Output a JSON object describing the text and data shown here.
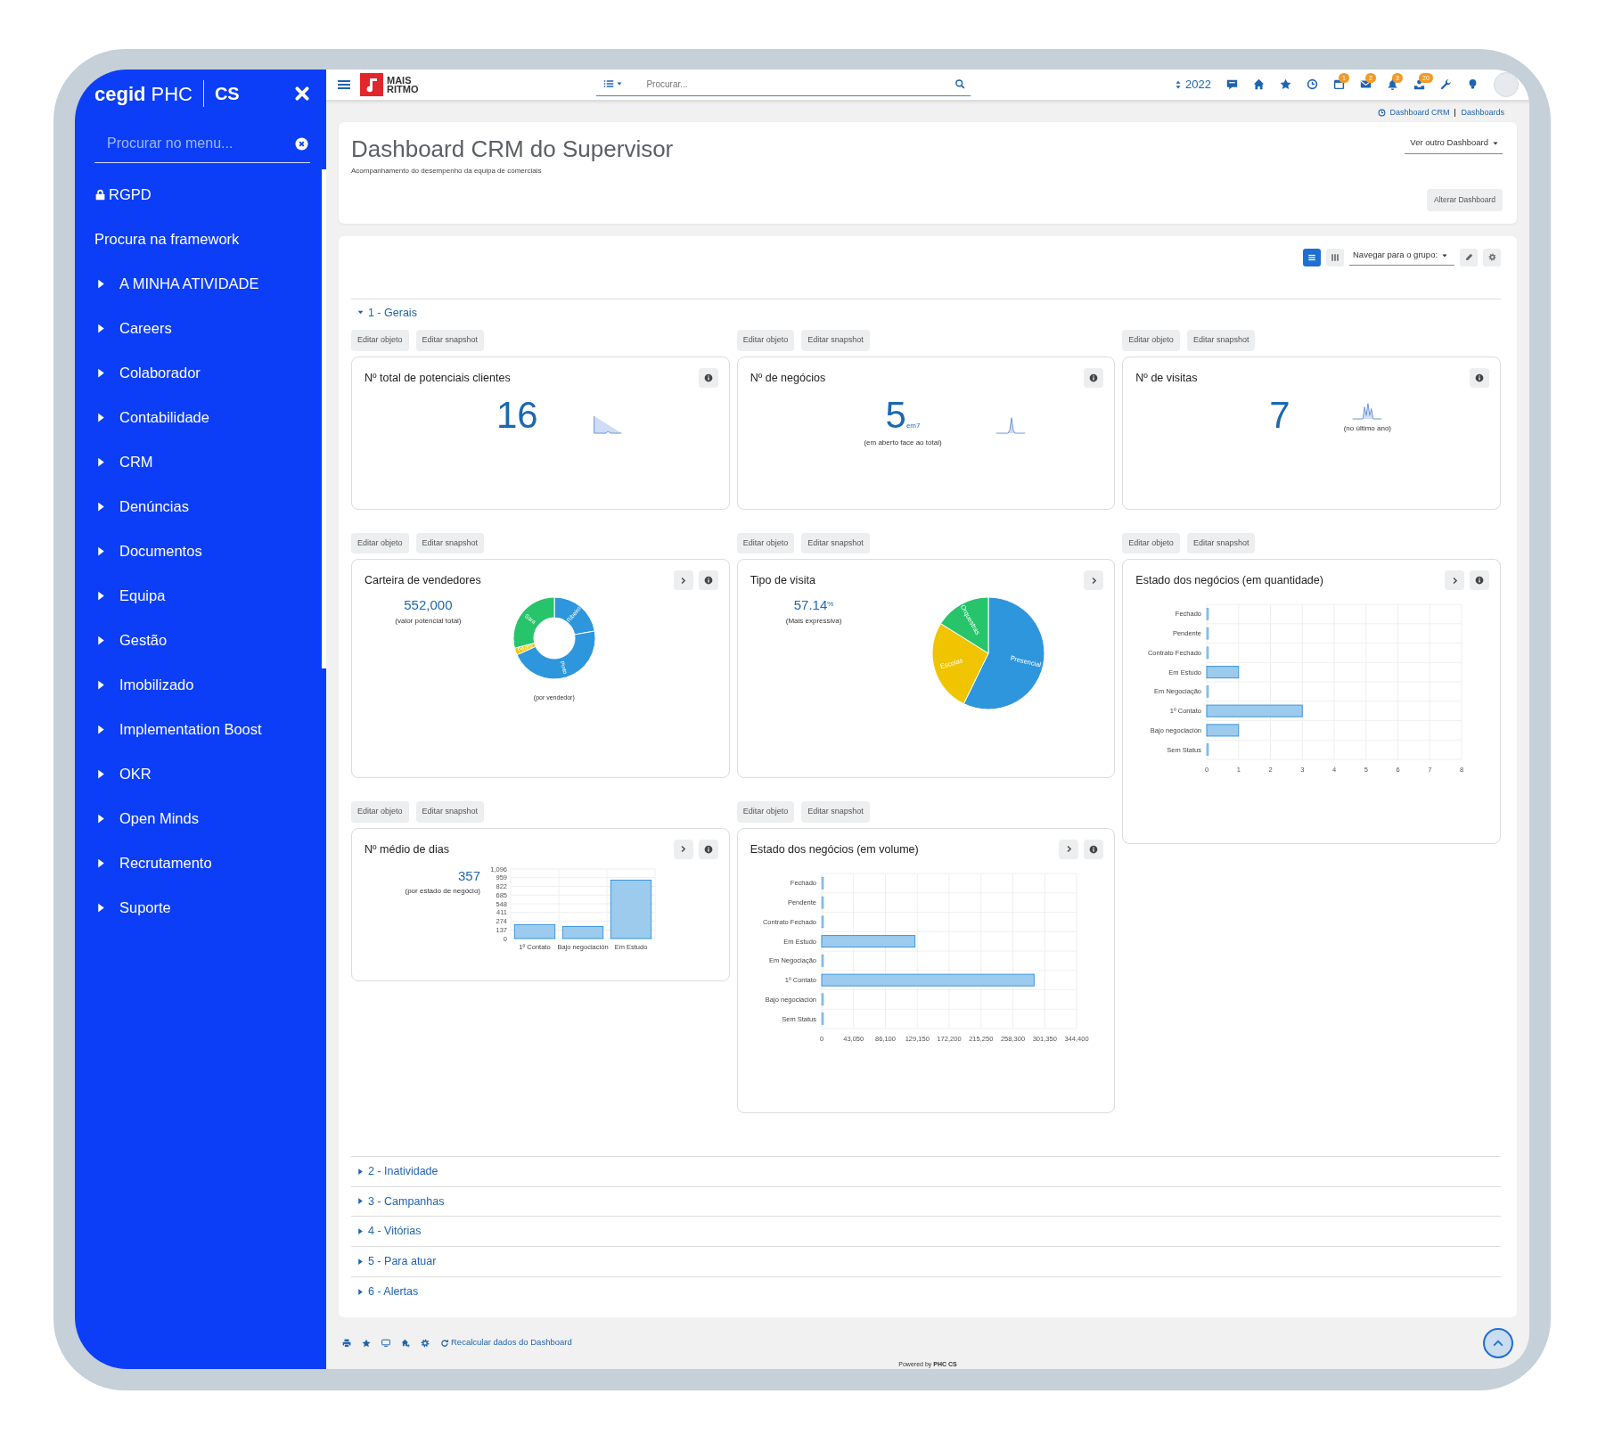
{
  "sidebar": {
    "brand": {
      "name": "cegid",
      "product": "PHC",
      "edition": "CS"
    },
    "search": {
      "placeholder": "Procurar no menu..."
    },
    "items": [
      {
        "label": "RGPD",
        "kind": "locked"
      },
      {
        "label": "Procura na framework",
        "kind": "link"
      },
      {
        "label": "A MINHA ATIVIDADE",
        "kind": "folder",
        "expanded": false
      },
      {
        "label": "Careers",
        "kind": "folder",
        "expanded": false
      },
      {
        "label": "Colaborador",
        "kind": "folder",
        "expanded": false
      },
      {
        "label": "Contabilidade",
        "kind": "folder",
        "expanded": false
      },
      {
        "label": "CRM",
        "kind": "folder",
        "expanded": false
      },
      {
        "label": "Denúncias",
        "kind": "folder",
        "expanded": false
      },
      {
        "label": "Documentos",
        "kind": "folder",
        "expanded": false
      },
      {
        "label": "Equipa",
        "kind": "folder",
        "expanded": false
      },
      {
        "label": "Gestão",
        "kind": "folder",
        "expanded": false
      },
      {
        "label": "Imobilizado",
        "kind": "folder",
        "expanded": false
      },
      {
        "label": "Implementation Boost",
        "kind": "folder",
        "expanded": false
      },
      {
        "label": "OKR",
        "kind": "folder",
        "expanded": false
      },
      {
        "label": "Open Minds",
        "kind": "folder",
        "expanded": false
      },
      {
        "label": "Recrutamento",
        "kind": "folder",
        "expanded": false
      },
      {
        "label": "Suporte",
        "kind": "folder",
        "expanded": false
      }
    ]
  },
  "topbar": {
    "brand": {
      "line1": "MAIS",
      "line2": "RITMO"
    },
    "search": {
      "placeholder": "Procurar..."
    },
    "year": "2022",
    "badges": [
      "1",
      "2",
      "3",
      "20"
    ]
  },
  "breadcrumb": [
    {
      "label": "Dashboard CRM"
    },
    {
      "label": "Dashboards"
    }
  ],
  "header": {
    "title": "Dashboard CRM do Supervisor",
    "subtitle": "Acompanhamento do desempenho da equipa de comerciais",
    "switch_label": "Ver outro Dashboard",
    "change_button": "Alterar Dashboard"
  },
  "toolbar": {
    "views": [
      {
        "kind": "list",
        "selected": true
      },
      {
        "kind": "columns",
        "selected": false
      }
    ],
    "navigate_label": "Navegar para o grupo:"
  },
  "groups": [
    {
      "label": "1 - Gerais",
      "expanded": true,
      "columns": [
        {
          "widgets": [
            {
              "kind": "kpi",
              "title": "Nº total de potenciais clientes",
              "edit_buttons": [
                "Editar objeto",
                "Editar snapshot"
              ],
              "has_next": false,
              "has_info": true,
              "value": "16"
            },
            {
              "kind": "donut",
              "title": "Carteira de vendedores",
              "edit_buttons": [
                "Editar objeto",
                "Editar snapshot"
              ],
              "has_next": true,
              "has_info": true,
              "value": "552,000",
              "caption": "(valor potencial total)",
              "footer": "(por vendedor)",
              "slices": [
                {
                  "label": "Ribeiro",
                  "color": "#2e96dd"
                },
                {
                  "label": "Pinto",
                  "color": "#2e96dd"
                },
                {
                  "label": "Pedro",
                  "color": "#f0c400"
                },
                {
                  "label": "Sara",
                  "color": "#27c46b"
                }
              ]
            },
            {
              "kind": "vbar",
              "title": "Nº médio de dias",
              "edit_buttons": [
                "Editar objeto",
                "Editar snapshot"
              ],
              "has_next": true,
              "has_info": true,
              "value": "357",
              "caption": "(por estado de negócio)",
              "chart_data": {
                "type": "bar",
                "categories": [
                  "1º Contato",
                  "Bajo negociación",
                  "Em Estudo"
                ],
                "values": [
                  220,
                  190,
                  920
                ],
                "grid": true,
                "ylim": [
                  0,
                  1096
                ],
                "yticks": [
                  0,
                  137,
                  274,
                  411,
                  548,
                  685,
                  822,
                  959,
                  {
                    "value": 1096,
                    "label": "1,096"
                  }
                ]
              }
            }
          ]
        },
        {
          "widgets": [
            {
              "kind": "kpi",
              "title": "Nº de negócios",
              "edit_buttons": [
                "Editar objeto",
                "Editar snapshot"
              ],
              "has_next": false,
              "has_info": true,
              "value": "5$_{em7}$",
              "caption": "(em aberto face ao total)"
            },
            {
              "kind": "pie",
              "title": "Tipo de visita",
              "edit_buttons": [
                "Editar objeto",
                "Editar snapshot"
              ],
              "has_next": true,
              "has_info": false,
              "value": "57.14$^{%}$",
              "caption": "(Mais expressiva)",
              "slices": [
                {
                  "label": "Presencial",
                  "color": "#2e96dd"
                },
                {
                  "label": "Escolas",
                  "color": "#f0c400"
                },
                {
                  "label": "Orquestras",
                  "color": "#27c46b"
                }
              ]
            },
            {
              "kind": "hbar",
              "title": "Estado dos negócios (em volume)",
              "edit_buttons": [
                "Editar objeto",
                "Editar snapshot"
              ],
              "has_next": true,
              "has_info": true,
              "chart_data": {
                "type": "bar",
                "orientation": "horizontal",
                "categories": [
                  "Fechado",
                  "Pendente",
                  "Contrato Fechado",
                  "Em Estudo",
                  "Em Negociação",
                  "1º Contato",
                  "Bajo negociación",
                  "Sem Status"
                ],
                "values": [
                  0,
                  0,
                  0,
                  126000,
                  0,
                  287000,
                  0,
                  0
                ],
                "grid": true,
                "xlim": [
                  0,
                  344400
                ],
                "xticks": [
                  0,
                  {
                    "value": 43050,
                    "label": "43,050"
                  },
                  {
                    "value": 86100,
                    "label": "86,100"
                  },
                  {
                    "value": 129150,
                    "label": "129,150"
                  },
                  {
                    "value": 172200,
                    "label": "172,200"
                  },
                  {
                    "value": 215250,
                    "label": "215,250"
                  },
                  {
                    "value": 258300,
                    "label": "258,300"
                  },
                  {
                    "value": 301350,
                    "label": "301,350"
                  },
                  {
                    "value": 344400,
                    "label": "344,400"
                  }
                ]
              }
            }
          ]
        },
        {
          "widgets": [
            {
              "kind": "kpi",
              "title": "Nº de visitas",
              "edit_buttons": [
                "Editar objeto",
                "Editar snapshot"
              ],
              "has_next": false,
              "has_info": true,
              "value": "7",
              "caption": "(no último ano)"
            },
            {
              "kind": "hbar",
              "title": "Estado dos negócios (em quantidade)",
              "edit_buttons": [
                "Editar objeto",
                "Editar snapshot"
              ],
              "has_next": true,
              "has_info": true,
              "chart_data": {
                "type": "bar",
                "orientation": "horizontal",
                "categories": [
                  "Fechado",
                  "Pendente",
                  "Contrato Fechado",
                  "Em Estudo",
                  "Em Negociação",
                  "1º Contato",
                  "Bajo negociación",
                  "Sem Status"
                ],
                "values": [
                  0,
                  0,
                  0,
                  1,
                  0,
                  3,
                  1,
                  0
                ],
                "grid": true,
                "xlim": [
                  0,
                  8
                ],
                "xticks": [
                  0,
                  1,
                  2,
                  3,
                  4,
                  5,
                  6,
                  7,
                  8
                ]
              }
            }
          ]
        }
      ]
    },
    {
      "label": "2 - Inatividade",
      "expanded": false
    },
    {
      "label": "3 - Campanhas",
      "expanded": false
    },
    {
      "label": "4 - Vitórias",
      "expanded": false
    },
    {
      "label": "5 - Para atuar",
      "expanded": false
    },
    {
      "label": "6 - Alertas",
      "expanded": false
    }
  ],
  "footer": {
    "recalc_label": "Recalcular dados do Dashboard",
    "powered": "Powered by **PHC CS**"
  }
}
